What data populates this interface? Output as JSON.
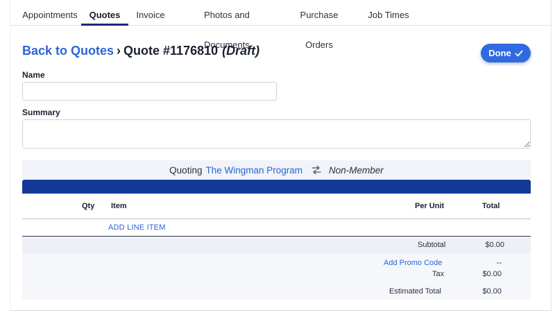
{
  "tabs": [
    {
      "label": "Appointments",
      "active": false
    },
    {
      "label": "Quotes",
      "active": true
    },
    {
      "label": "Invoice",
      "active": false
    },
    {
      "label": "Photos and Documents",
      "active": false
    },
    {
      "label": "Purchase Orders",
      "active": false
    },
    {
      "label": "Job Times",
      "active": false
    }
  ],
  "header": {
    "back_link": "Back to Quotes",
    "separator": "›",
    "quote_title": "Quote #1176810",
    "quote_status": "(Draft)",
    "done_label": "Done"
  },
  "form": {
    "name_label": "Name",
    "name_value": "",
    "summary_label": "Summary",
    "summary_value": ""
  },
  "quoting": {
    "prefix": "Quoting",
    "program": "The Wingman Program",
    "membership": "Non-Member"
  },
  "table": {
    "columns": {
      "qty": "Qty",
      "item": "Item",
      "per_unit": "Per Unit",
      "total": "Total"
    },
    "add_line_item": "ADD LINE ITEM"
  },
  "totals": {
    "subtotal_label": "Subtotal",
    "subtotal_value": "$0.00",
    "promo_label": "Add Promo Code",
    "promo_value": "--",
    "tax_label": "Tax",
    "tax_value": "$0.00",
    "estimated_label": "Estimated Total",
    "estimated_value": "$0.00"
  },
  "colors": {
    "accent": "#2f6ae0",
    "link": "#2a64d6",
    "header_band": "#143996"
  }
}
